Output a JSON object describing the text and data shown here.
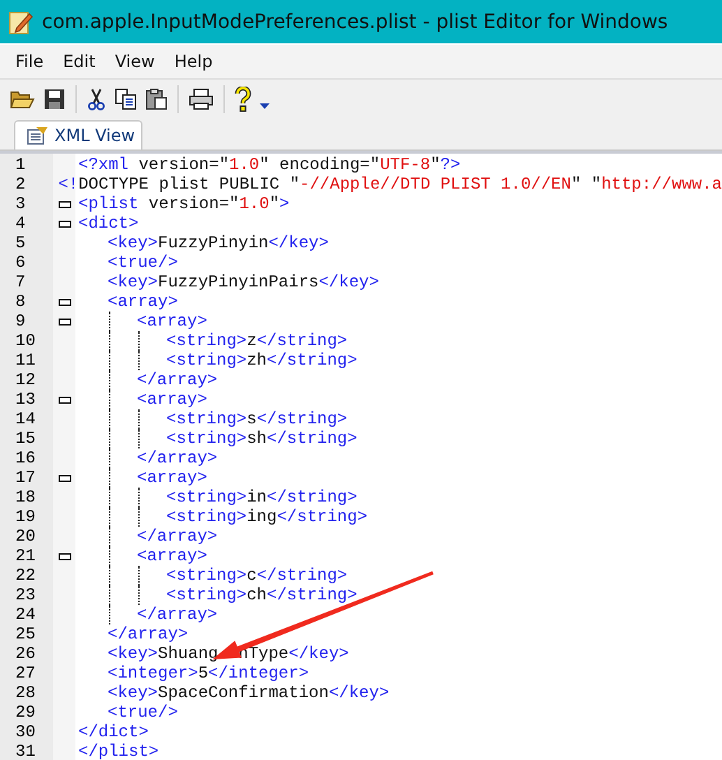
{
  "window": {
    "title": "com.apple.InputModePreferences.plist - plist Editor for Windows"
  },
  "menu": [
    "File",
    "Edit",
    "View",
    "Help"
  ],
  "tabs": [
    {
      "label": "XML View",
      "selected": true
    }
  ],
  "editor": {
    "lines": [
      {
        "number": "1",
        "text": "<?xml version=\"1.0\" encoding=\"UTF-8\"?>"
      },
      {
        "number": "2",
        "text": "<!DOCTYPE plist PUBLIC \"-//Apple//DTD PLIST 1.0//EN\" \"http://www.a"
      },
      {
        "number": "3",
        "text": "<plist version=\"1.0\">",
        "expanded": true,
        "children": [
          {
            "number": "4",
            "text": "<dict>",
            "expanded": true,
            "children": [
              {
                "number": "5",
                "text": "<key>FuzzyPinyin</key>"
              },
              {
                "number": "6",
                "text": "<true/>"
              },
              {
                "number": "7",
                "text": "<key>FuzzyPinyinPairs</key>"
              },
              {
                "number": "8",
                "text": "<array>",
                "expanded": true,
                "children": [
                  {
                    "number": "9",
                    "text": "<array>",
                    "expanded": true,
                    "children": [
                      {
                        "number": "10",
                        "text": "<string>z</string>"
                      },
                      {
                        "number": "11",
                        "text": "<string>zh</string>"
                      }
                    ],
                    "end": {
                      "number": "12",
                      "text": "</array>"
                    }
                  },
                  {
                    "number": "13",
                    "text": "<array>",
                    "expanded": true,
                    "children": [
                      {
                        "number": "14",
                        "text": "<string>s</string>"
                      },
                      {
                        "number": "15",
                        "text": "<string>sh</string>"
                      }
                    ],
                    "end": {
                      "number": "16",
                      "text": "</array>"
                    }
                  },
                  {
                    "number": "17",
                    "text": "<array>",
                    "expanded": true,
                    "children": [
                      {
                        "number": "18",
                        "text": "<string>in</string>"
                      },
                      {
                        "number": "19",
                        "text": "<string>ing</string>"
                      }
                    ],
                    "end": {
                      "number": "20",
                      "text": "</array>"
                    }
                  },
                  {
                    "number": "21",
                    "text": "<array>",
                    "expanded": true,
                    "children": [
                      {
                        "number": "22",
                        "text": "<string>c</string>"
                      },
                      {
                        "number": "23",
                        "text": "<string>ch</string>"
                      }
                    ],
                    "end": {
                      "number": "24",
                      "text": "</array>"
                    }
                  }
                ],
                "end": {
                  "number": "25",
                  "text": "</array>"
                }
              },
              {
                "number": "26",
                "text": "<key>Shuang",
                "text_after": "nType</key>"
              },
              {
                "number": "27",
                "text": "<integer>5</integer>"
              },
              {
                "number": "28",
                "text": "<key>SpaceConfirmation</key>"
              },
              {
                "number": "29",
                "text": "<true/>"
              }
            ],
            "end": {
              "number": "30",
              "text": "</dict>"
            }
          }
        ],
        "end": {
          "number": "31",
          "text": "</plist>"
        }
      }
    ]
  }
}
